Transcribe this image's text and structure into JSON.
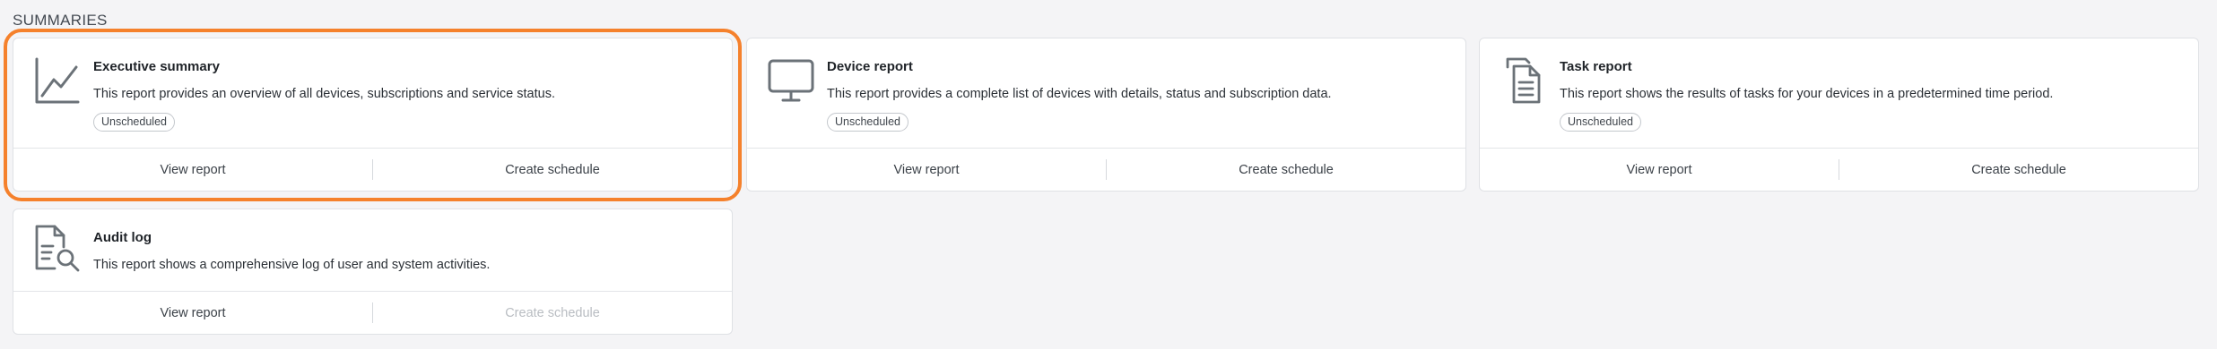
{
  "section": {
    "title": "SUMMARIES"
  },
  "highlight_color": "#f5812c",
  "cards": [
    {
      "icon": "line-chart-icon",
      "title": "Executive summary",
      "description": "This report provides an overview of all devices, subscriptions and service status.",
      "badge": "Unscheduled",
      "view_label": "View report",
      "schedule_label": "Create schedule",
      "schedule_enabled": true,
      "highlighted": true
    },
    {
      "icon": "monitor-icon",
      "title": "Device report",
      "description": "This report provides a complete list of devices with details, status and subscription data.",
      "badge": "Unscheduled",
      "view_label": "View report",
      "schedule_label": "Create schedule",
      "schedule_enabled": true
    },
    {
      "icon": "documents-icon",
      "title": "Task report",
      "description": "This report shows the results of tasks for your devices in a predetermined time period.",
      "badge": "Unscheduled",
      "view_label": "View report",
      "schedule_label": "Create schedule",
      "schedule_enabled": true
    },
    {
      "icon": "document-search-icon",
      "title": "Audit log",
      "description": "This report shows a comprehensive log of user and system activities.",
      "view_label": "View report",
      "schedule_label": "Create schedule",
      "schedule_enabled": false
    }
  ]
}
